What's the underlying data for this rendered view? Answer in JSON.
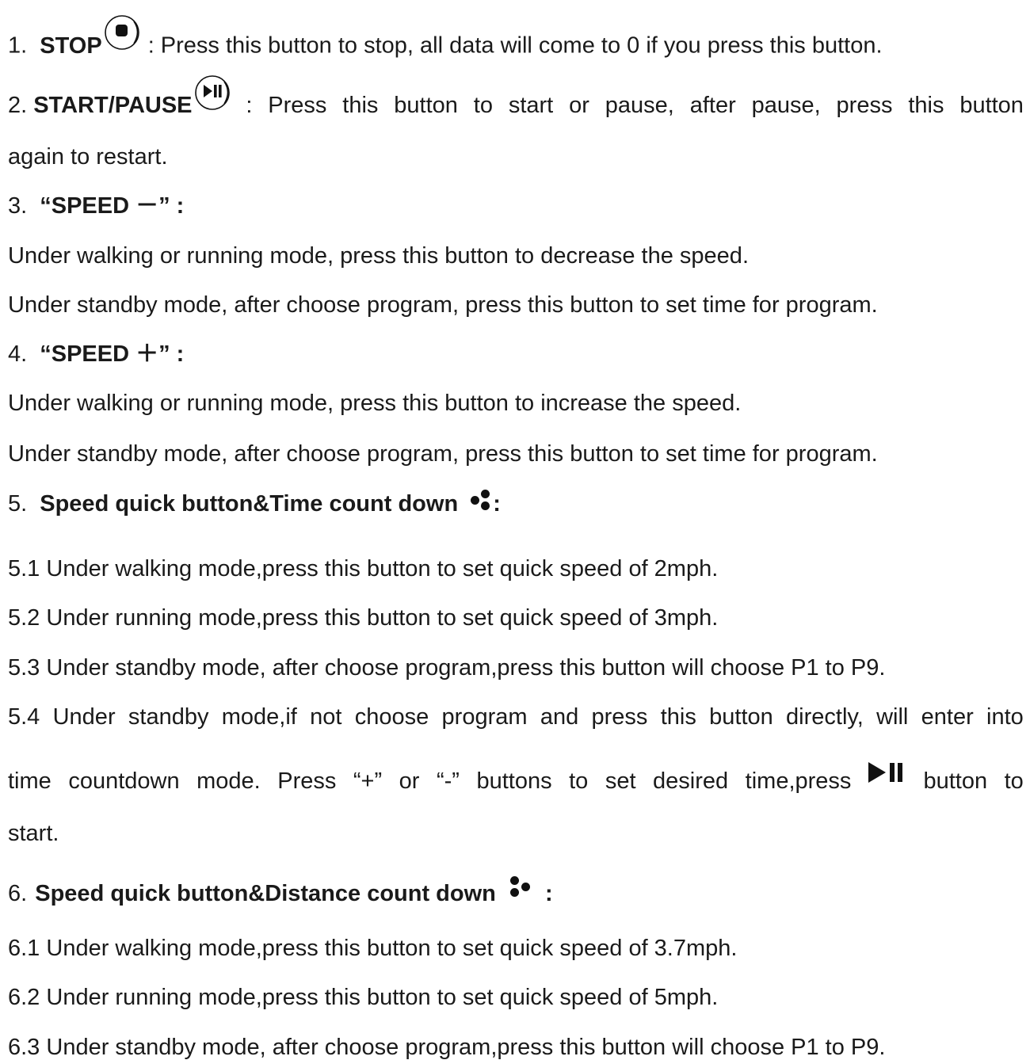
{
  "items": {
    "stop": {
      "num": "1.",
      "title": "STOP",
      "desc": ": Press this button to stop, all data will come to 0 if you press this button."
    },
    "start_pause": {
      "num": "2.",
      "title": "START/PAUSE",
      "desc_words": [
        ":",
        "Press",
        "this",
        "button",
        "to",
        "start",
        "or",
        "pause,",
        "after",
        "pause,",
        "press",
        "this",
        "button"
      ],
      "desc_cont": "again to restart."
    },
    "speed_minus": {
      "num": "3.",
      "title": "“SPEED －” :",
      "lines": [
        "Under walking or running mode, press this button to decrease the speed.",
        "Under standby mode, after choose program, press this button to set time for program."
      ]
    },
    "speed_plus": {
      "num": "4.",
      "title": "“SPEED ＋” :",
      "lines": [
        "Under walking or running mode, press this button to increase the speed.",
        "Under standby mode, after choose program, press this button to set time for program."
      ]
    },
    "time_countdown": {
      "num": "5.",
      "title": "Speed quick button&Time count down",
      "colon": ":",
      "lines": [
        "5.1 Under walking mode,press this button to set quick speed of 2mph.",
        "5.2 Under running mode,press this button to set quick speed of 3mph.",
        "5.3 Under standby mode, after choose program,press this button will choose P1 to P9."
      ],
      "line4_words": [
        "5.4",
        "Under",
        "standby",
        "mode,if",
        "not",
        "choose",
        "program",
        "and",
        "press",
        "this",
        "button",
        "directly,",
        "will",
        "enter",
        "into"
      ],
      "line5_words": [
        "time",
        "countdown",
        "mode.",
        "Press",
        "“+”",
        "or",
        "“-”",
        "buttons",
        "to",
        "set",
        "desired",
        "time,press"
      ],
      "line5_after": [
        "button",
        "to"
      ],
      "line6": "start."
    },
    "distance_countdown": {
      "num": "6.",
      "title": "Speed quick button&Distance count down",
      "colon": ":",
      "lines": [
        "6.1 Under walking mode,press this button to set quick speed of 3.7mph.",
        "6.2 Under running mode,press this button to set quick speed of 5mph.",
        "6.3 Under standby mode, after choose program,press this button will choose P1 to P9."
      ]
    }
  }
}
